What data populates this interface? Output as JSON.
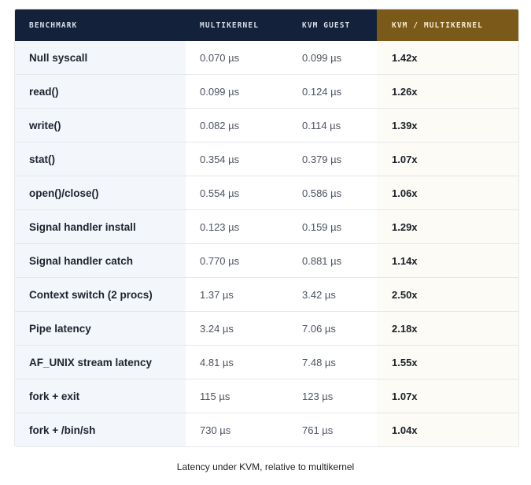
{
  "table": {
    "headers": [
      "BENCHMARK",
      "MULTIKERNEL",
      "KVM GUEST",
      "KVM / MULTIKERNEL"
    ],
    "rows": [
      {
        "benchmark": "Null syscall",
        "multikernel": "0.070 µs",
        "kvm_guest": "0.099 µs",
        "ratio": "1.42x"
      },
      {
        "benchmark": "read()",
        "multikernel": "0.099 µs",
        "kvm_guest": "0.124 µs",
        "ratio": "1.26x"
      },
      {
        "benchmark": "write()",
        "multikernel": "0.082 µs",
        "kvm_guest": "0.114 µs",
        "ratio": "1.39x"
      },
      {
        "benchmark": "stat()",
        "multikernel": "0.354 µs",
        "kvm_guest": "0.379 µs",
        "ratio": "1.07x"
      },
      {
        "benchmark": "open()/close()",
        "multikernel": "0.554 µs",
        "kvm_guest": "0.586 µs",
        "ratio": "1.06x"
      },
      {
        "benchmark": "Signal handler install",
        "multikernel": "0.123 µs",
        "kvm_guest": "0.159 µs",
        "ratio": "1.29x"
      },
      {
        "benchmark": "Signal handler catch",
        "multikernel": "0.770 µs",
        "kvm_guest": "0.881 µs",
        "ratio": "1.14x"
      },
      {
        "benchmark": "Context switch (2 procs)",
        "multikernel": "1.37 µs",
        "kvm_guest": "3.42 µs",
        "ratio": "2.50x"
      },
      {
        "benchmark": "Pipe latency",
        "multikernel": "3.24 µs",
        "kvm_guest": "7.06 µs",
        "ratio": "2.18x"
      },
      {
        "benchmark": "AF_UNIX stream latency",
        "multikernel": "4.81 µs",
        "kvm_guest": "7.48 µs",
        "ratio": "1.55x"
      },
      {
        "benchmark": "fork + exit",
        "multikernel": "115 µs",
        "kvm_guest": "123 µs",
        "ratio": "1.07x"
      },
      {
        "benchmark": "fork + /bin/sh",
        "multikernel": "730 µs",
        "kvm_guest": "761 µs",
        "ratio": "1.04x"
      }
    ]
  },
  "caption": "Latency under KVM, relative to multikernel",
  "colors": {
    "header_bg": "#13213a",
    "ratio_header_bg": "#7b5a19",
    "benchmark_col_bg": "#f3f6fa",
    "ratio_col_bg": "#fcfbf5"
  }
}
